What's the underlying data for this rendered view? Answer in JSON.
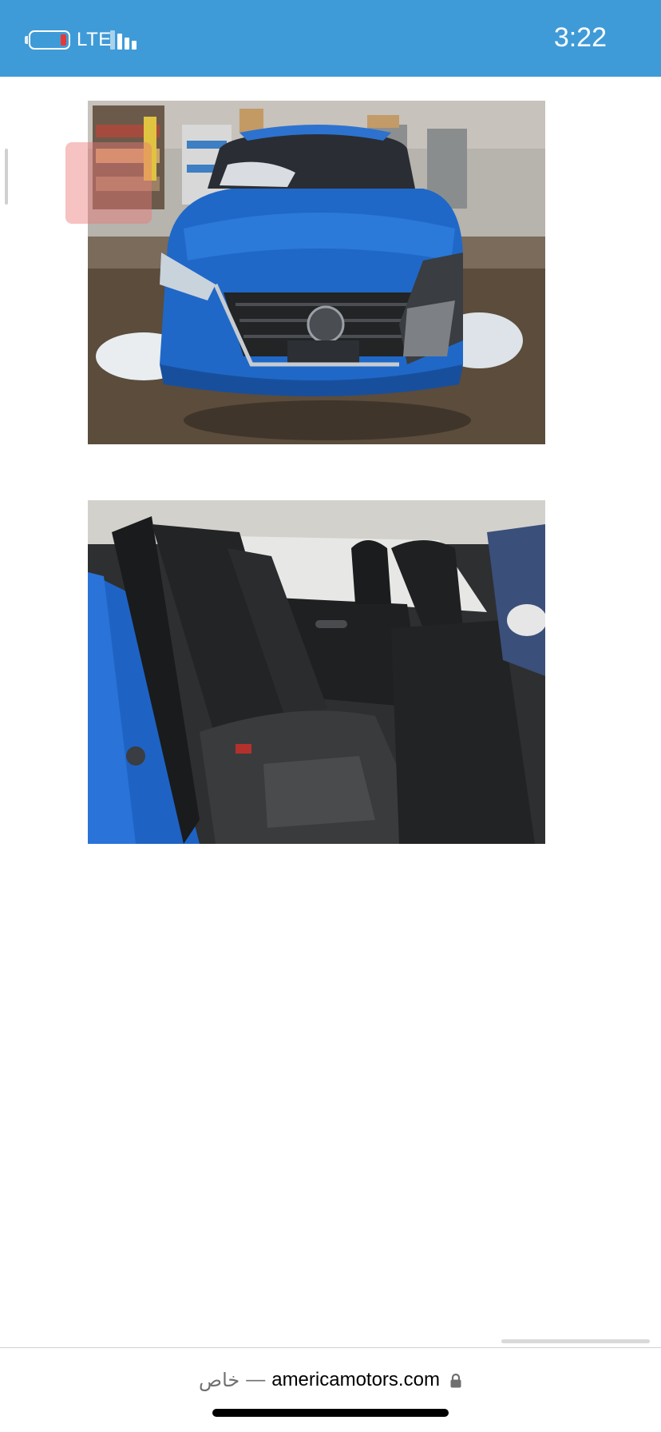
{
  "status_bar": {
    "network": "LTE",
    "time": "3:22",
    "battery_level": 0.15,
    "background_color": "#3f9bd7"
  },
  "photos": [
    {
      "label": "",
      "icon": "car-front-damaged-photo"
    },
    {
      "label": "",
      "icon": "car-interior-rear-seat-photo"
    }
  ],
  "address_bar": {
    "private_label": "خاص",
    "separator": "—",
    "domain": "americamotors.com",
    "icon": "lock-icon"
  }
}
